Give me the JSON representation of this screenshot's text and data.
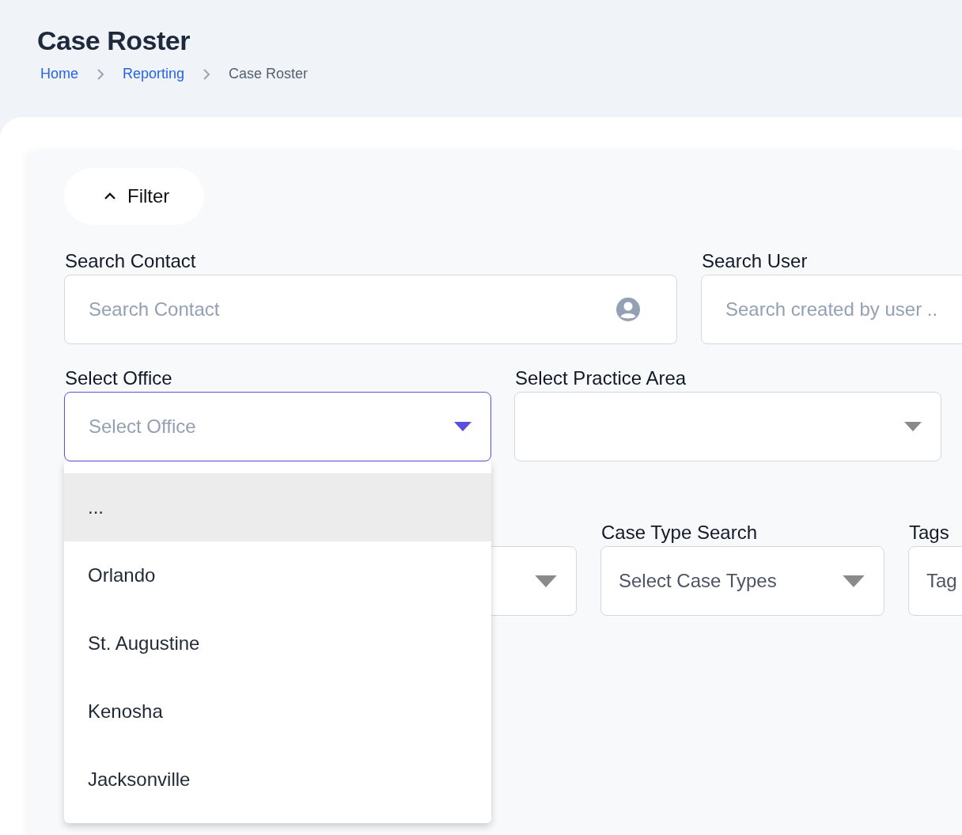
{
  "header": {
    "title": "Case Roster",
    "breadcrumb": [
      {
        "label": "Home",
        "kind": "link"
      },
      {
        "label": "Reporting",
        "kind": "link"
      },
      {
        "label": "Case Roster",
        "kind": "current"
      }
    ]
  },
  "filter": {
    "label": "Filter",
    "expanded": true
  },
  "field_rows": [
    {
      "fields": [
        {
          "kind": "contact",
          "label": "Search Contact",
          "placeholder": "Search Contact",
          "focused": false
        },
        {
          "kind": "text",
          "label": "Search User",
          "placeholder": "Search created by user ..",
          "focused": false
        }
      ]
    },
    {
      "fields": [
        {
          "kind": "select",
          "label": "Select Office",
          "placeholder": "Select Office",
          "focused": true,
          "open": true,
          "options": [
            {
              "label": "...",
              "selected": true
            },
            {
              "label": "Orlando",
              "selected": false
            },
            {
              "label": "St. Augustine",
              "selected": false
            },
            {
              "label": "Kenosha",
              "selected": false
            },
            {
              "label": "Jacksonville",
              "selected": false
            }
          ]
        },
        {
          "kind": "select",
          "label": "Select Practice Area",
          "focused": false
        }
      ]
    },
    {
      "fields": [
        {
          "kind": "select",
          "focused": false
        },
        {
          "kind": "select",
          "label": "Case Type Search",
          "placeholder": "Select Case Types",
          "focused": false
        },
        {
          "kind": "text",
          "label": "Tags",
          "placeholder": "Tag",
          "focused": false
        }
      ]
    }
  ]
}
